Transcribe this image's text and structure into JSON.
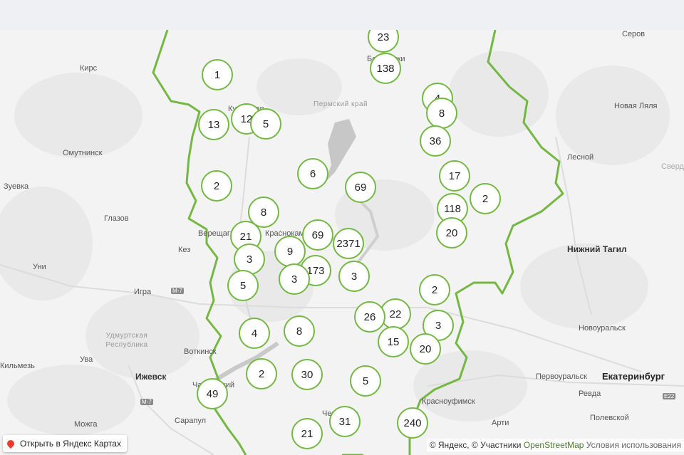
{
  "map": {
    "clusters": [
      {
        "label": "23"
      },
      {
        "label": "138"
      },
      {
        "label": "1"
      },
      {
        "label": "4"
      },
      {
        "label": "8"
      },
      {
        "label": "12"
      },
      {
        "label": "13"
      },
      {
        "label": "5"
      },
      {
        "label": "36"
      },
      {
        "label": "6"
      },
      {
        "label": "2"
      },
      {
        "label": "69"
      },
      {
        "label": "17"
      },
      {
        "label": "2"
      },
      {
        "label": "8"
      },
      {
        "label": "118"
      },
      {
        "label": "21"
      },
      {
        "label": "69"
      },
      {
        "label": "2371"
      },
      {
        "label": "20"
      },
      {
        "label": "3"
      },
      {
        "label": "9"
      },
      {
        "label": "173"
      },
      {
        "label": "3"
      },
      {
        "label": "3"
      },
      {
        "label": "5"
      },
      {
        "label": "2"
      },
      {
        "label": "22"
      },
      {
        "label": "26"
      },
      {
        "label": "4"
      },
      {
        "label": "8"
      },
      {
        "label": "3"
      },
      {
        "label": "15"
      },
      {
        "label": "20"
      },
      {
        "label": "2"
      },
      {
        "label": "30"
      },
      {
        "label": "5"
      },
      {
        "label": "49"
      },
      {
        "label": "31"
      },
      {
        "label": "240"
      },
      {
        "label": "21"
      }
    ],
    "places": [
      "Серов",
      "Кирс",
      "Пермский край",
      "Новая Ляля",
      "Омутнинск",
      "Лесной",
      "Зуевка",
      "Сверд",
      "Глазов",
      "Верещагино",
      "Краснокамск",
      "Кез",
      "Нижний Тагил",
      "Уни",
      "Игра",
      "Удмуртская Республика",
      "Новоуральск",
      "Воткинск",
      "Ува",
      "Ижевск",
      "Первоуральск",
      "Екатеринбург",
      "Ревда",
      "Полевской",
      "Можга",
      "Сарапул",
      "Красноуфимск",
      "Арти",
      "Кильмезь",
      "Березники",
      "Кудымкар",
      "Чайковский",
      "Чернушка"
    ],
    "roads": [
      "M-7",
      "M-7",
      "E22"
    ]
  },
  "controls": {
    "open_in_yandex": "Открыть в Яндекс Картах"
  },
  "attribution": {
    "yandex": "© Яндекс, © Участники ",
    "osm": "OpenStreetMap",
    "terms": " Условия использования"
  },
  "colors": {
    "border": "#74b843",
    "cluster_border": "#74b843",
    "pin": "#ea3b2e"
  }
}
